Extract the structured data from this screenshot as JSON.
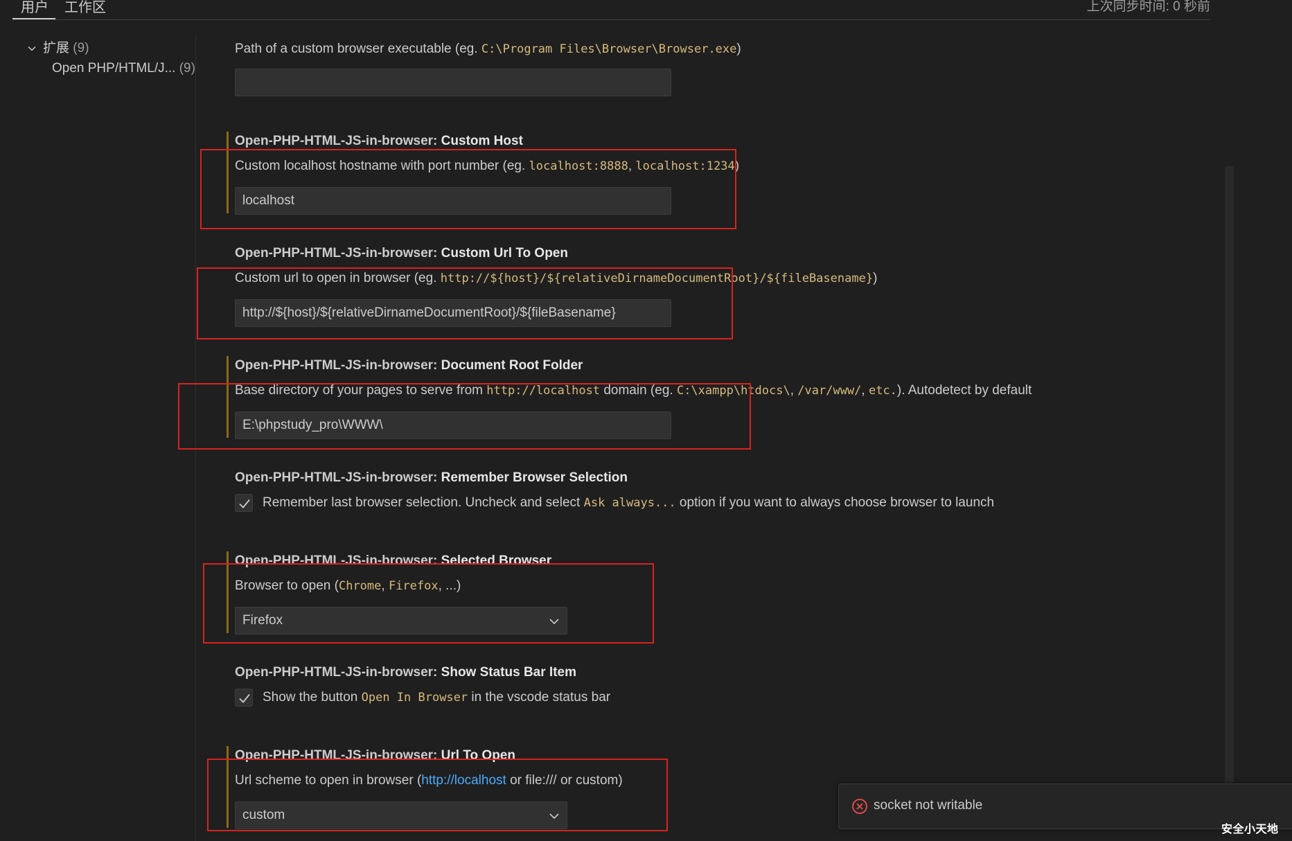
{
  "tabs": {
    "user": "用户",
    "workspace": "工作区",
    "sync_status": "上次同步时间: 0 秒前"
  },
  "toc": {
    "extensions_label": "扩展",
    "extensions_count": "(9)",
    "child_label": "Open PHP/HTML/J...",
    "child_count": "(9)"
  },
  "settings": {
    "category": "Open-PHP-HTML-JS-in-browser:",
    "custom_browser_path": {
      "desc_prefix": "Path of a custom browser executable (eg. ",
      "desc_code": "C:\\Program Files\\Browser\\Browser.exe",
      "desc_suffix": ")",
      "value": ""
    },
    "custom_host": {
      "name": "Custom Host",
      "desc_prefix": "Custom localhost hostname with port number (eg. ",
      "desc_code1": "localhost:8888",
      "desc_sep": ", ",
      "desc_code2": "localhost:1234",
      "desc_suffix": ")",
      "value": "localhost"
    },
    "custom_url": {
      "name": "Custom Url To Open",
      "desc_prefix": "Custom url to open in browser (eg. ",
      "desc_code": "http://${host}/${relativeDirnameDocumentRoot}/${fileBasename}",
      "desc_suffix": ")",
      "value": "http://${host}/${relativeDirnameDocumentRoot}/${fileBasename}"
    },
    "doc_root": {
      "name": "Document Root Folder",
      "desc_prefix": "Base directory of your pages to serve from ",
      "desc_code1": "http://localhost",
      "desc_mid": " domain (eg. ",
      "desc_code2": "C:\\xampp\\htdocs\\",
      "desc_sep1": ", ",
      "desc_code3": "/var/www/",
      "desc_sep2": ", ",
      "desc_code4": "etc.",
      "desc_suffix": "). Autodetect by default",
      "value": "E:\\phpstudy_pro\\WWW\\"
    },
    "remember_browser": {
      "name": "Remember Browser Selection",
      "label_prefix": "Remember last browser selection. Uncheck and select ",
      "label_code": "Ask always...",
      "label_suffix": " option if you want to always choose browser to launch",
      "checked": true
    },
    "selected_browser": {
      "name": "Selected Browser",
      "desc_prefix": "Browser to open (",
      "desc_code1": "Chrome",
      "desc_sep": ", ",
      "desc_code2": "Firefox",
      "desc_suffix": ", ...)",
      "value": "Firefox"
    },
    "status_bar_item": {
      "name": "Show Status Bar Item",
      "label_prefix": "Show the button ",
      "label_code": "Open In Browser",
      "label_suffix": " in the vscode status bar",
      "checked": true
    },
    "url_to_open": {
      "name": "Url To Open",
      "desc_prefix": "Url scheme to open in browser (",
      "desc_link": "http://localhost",
      "desc_suffix": " or file:/// or custom)",
      "value": "custom"
    }
  },
  "notification": {
    "message": "socket not writable",
    "icon": "error-circle-icon"
  },
  "watermark": "安全小天地",
  "colors": {
    "background": "#1f1f1f",
    "code": "#d7ba7d",
    "link": "#4daafc",
    "modified_bar": "#8b6a14",
    "annotation": "#d8231f",
    "error": "#f14c4c"
  }
}
